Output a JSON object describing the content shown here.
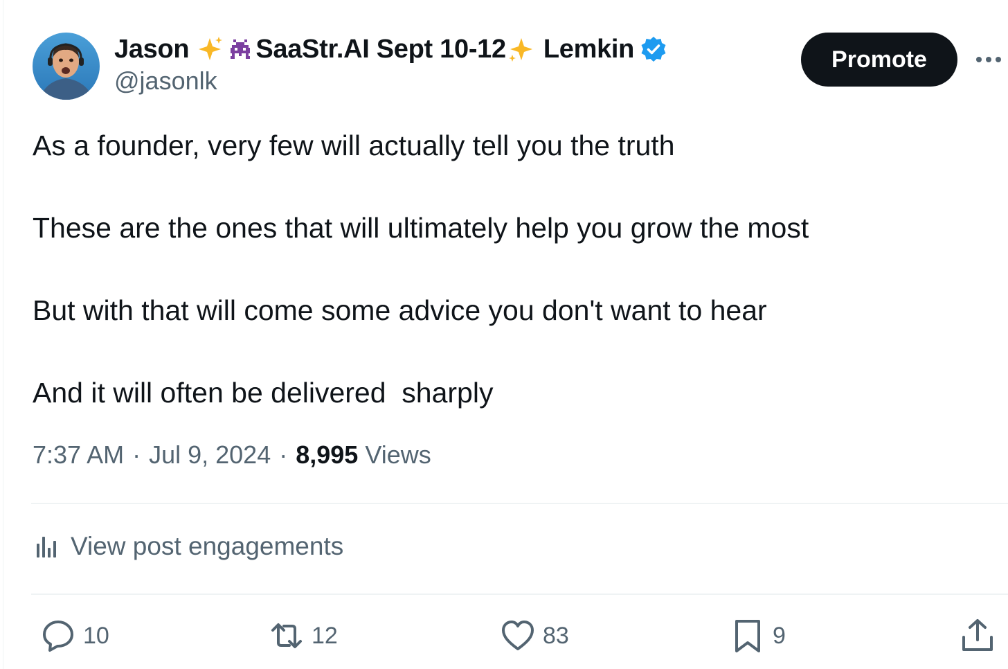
{
  "author": {
    "name_parts": [
      "Jason",
      "SaaStr.AI Sept 10-12",
      "Lemkin"
    ],
    "handle": "@jasonlk"
  },
  "header": {
    "promote_label": "Promote"
  },
  "tweet": {
    "lines": [
      "As a founder, very few will actually tell you the truth",
      "These are the ones that will ultimately help you grow the most",
      "But with that will come some advice you don't want to hear",
      "And it will often be delivered  sharply"
    ]
  },
  "meta": {
    "time": "7:37 AM",
    "separator": "·",
    "date": "Jul 9, 2024",
    "views_count": "8,995",
    "views_label": "Views"
  },
  "engagements": {
    "label": "View post engagements"
  },
  "actions": {
    "reply_count": "10",
    "repost_count": "12",
    "like_count": "83",
    "bookmark_count": "9"
  },
  "colors": {
    "text": "#0f1419",
    "secondary": "#536471",
    "verified_blue": "#1d9bf0",
    "sparkle_gold": "#f9b826",
    "alien_purple": "#7b3fa0",
    "divider": "#eff3f4"
  },
  "icons": [
    "avatar",
    "sparkles-icon",
    "alien-monster-icon",
    "verified-badge-icon",
    "more-icon",
    "bar-chart-icon",
    "reply-icon",
    "repost-icon",
    "like-icon",
    "bookmark-icon",
    "share-icon"
  ]
}
